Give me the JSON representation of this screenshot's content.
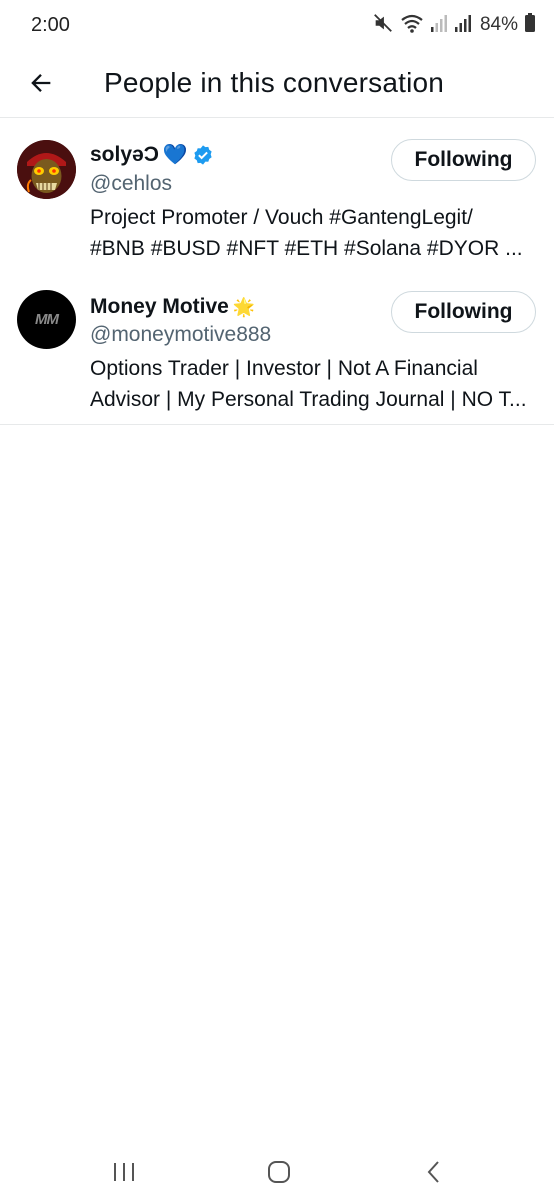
{
  "status_bar": {
    "time": "2:00",
    "battery": "84%",
    "icons": [
      "mute-icon",
      "wifi-icon",
      "signal-icon",
      "signal-icon",
      "battery-icon"
    ]
  },
  "header": {
    "title": "People in this conversation",
    "back_icon": "arrow-left-icon"
  },
  "users": [
    {
      "display_name": "solyəƆ",
      "name_emoji": "💙",
      "verified": true,
      "handle": "@cehlos",
      "bio_line1": "Project Promoter / Vouch #GantengLegit/",
      "bio_line2": "#BNB #BUSD #NFT #ETH #Solana #DYOR ...",
      "follow_label": "Following"
    },
    {
      "display_name": "Money Motive",
      "name_emoji": "🌟",
      "verified": false,
      "avatar_text": "MM",
      "handle": "@moneymotive888",
      "bio_line1": "Options Trader | Investor | Not A Financial",
      "bio_line2": "Advisor | My Personal Trading Journal | NO T...",
      "follow_label": "Following"
    }
  ],
  "colors": {
    "text_primary": "#0f1419",
    "text_secondary": "#536471",
    "verified_blue": "#1d9bf0",
    "border": "#cfd9de"
  },
  "nav_bar": {
    "icons": [
      "recent-apps-icon",
      "home-icon",
      "back-icon"
    ]
  }
}
